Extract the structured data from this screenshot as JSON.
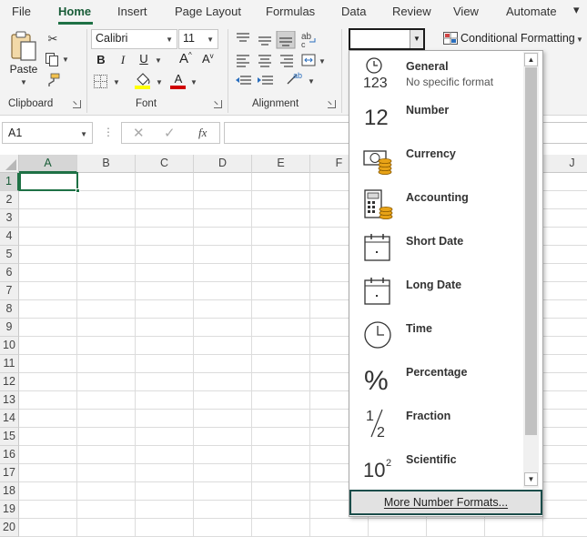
{
  "ribbon_tabs": [
    "File",
    "Home",
    "Insert",
    "Page Layout",
    "Formulas",
    "Data",
    "Review",
    "View",
    "Automate"
  ],
  "clipboard": {
    "paste_label": "Paste",
    "group_label": "Clipboard"
  },
  "font": {
    "name": "Calibri",
    "size": "11",
    "bold": "B",
    "italic": "I",
    "underline": "U",
    "grow": "A",
    "shrink": "A",
    "group_label": "Font"
  },
  "alignment": {
    "group_label": "Alignment"
  },
  "number_format": {
    "value": ""
  },
  "styles": {
    "conditional_formatting_label": "Conditional Formatting"
  },
  "formula_bar": {
    "name_box": "A1",
    "function_label": "fx",
    "formula": ""
  },
  "columns": [
    "A",
    "B",
    "C",
    "D",
    "E",
    "F",
    "J"
  ],
  "rows": [
    "1",
    "2",
    "3",
    "4",
    "5",
    "6",
    "7",
    "8",
    "9",
    "10",
    "11",
    "12",
    "13",
    "14",
    "15",
    "16",
    "17",
    "18",
    "19",
    "20"
  ],
  "active_cell": "A1",
  "dropdown": {
    "items": [
      {
        "title": "General",
        "subtitle": "No specific format",
        "icon": "general-clock-123-icon",
        "glyph": "123"
      },
      {
        "title": "Number",
        "subtitle": "",
        "icon": "number-12-icon",
        "glyph": "12"
      },
      {
        "title": "Currency",
        "subtitle": "",
        "icon": "currency-bill-coins-icon",
        "glyph": ""
      },
      {
        "title": "Accounting",
        "subtitle": "",
        "icon": "accounting-calculator-icon",
        "glyph": ""
      },
      {
        "title": "Short Date",
        "subtitle": "",
        "icon": "short-date-calendar-icon",
        "glyph": ""
      },
      {
        "title": "Long Date",
        "subtitle": "",
        "icon": "long-date-calendar-icon",
        "glyph": ""
      },
      {
        "title": "Time",
        "subtitle": "",
        "icon": "time-clock-icon",
        "glyph": ""
      },
      {
        "title": "Percentage",
        "subtitle": "",
        "icon": "percentage-icon",
        "glyph": "%"
      },
      {
        "title": "Fraction",
        "subtitle": "",
        "icon": "fraction-half-icon",
        "glyph": "½"
      },
      {
        "title": "Scientific",
        "subtitle": "",
        "icon": "scientific-ten-squared-icon",
        "glyph": "10²"
      }
    ],
    "more_label": "More Number Formats..."
  },
  "colors": {
    "accent": "#1e7145",
    "more_border": "#1b4d4a",
    "coin": "#e8a317",
    "font_color_bar": "#d00000",
    "highlight_bar": "#ffff00"
  }
}
